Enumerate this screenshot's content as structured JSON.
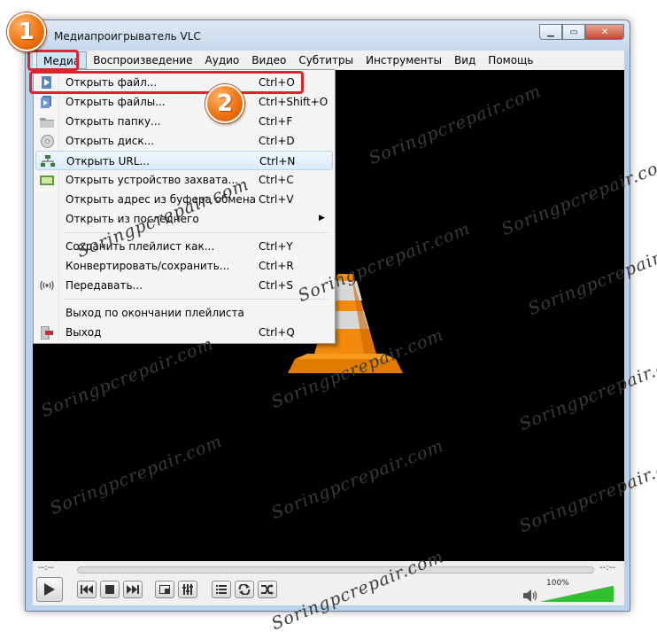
{
  "window": {
    "title": "Медиапроигрыватель VLC"
  },
  "menubar": [
    {
      "label": "Медиа"
    },
    {
      "label": "Воспроизведение"
    },
    {
      "label": "Аудио"
    },
    {
      "label": "Видео"
    },
    {
      "label": "Субтитры"
    },
    {
      "label": "Инструменты"
    },
    {
      "label": "Вид"
    },
    {
      "label": "Помощь"
    }
  ],
  "media_menu": [
    {
      "label": "Открыть файл...",
      "shortcut": "Ctrl+O",
      "icon": "open-file-icon"
    },
    {
      "label": "Открыть файлы...",
      "shortcut": "Ctrl+Shift+O",
      "icon": "open-files-icon"
    },
    {
      "label": "Открыть папку...",
      "shortcut": "Ctrl+F",
      "icon": "folder-icon"
    },
    {
      "label": "Открыть диск...",
      "shortcut": "Ctrl+D",
      "icon": "disc-icon"
    },
    {
      "label": "Открыть URL...",
      "shortcut": "Ctrl+N",
      "icon": "network-icon"
    },
    {
      "label": "Открыть устройство захвата...",
      "shortcut": "Ctrl+C",
      "icon": "capture-device-icon"
    },
    {
      "label": "Открыть адрес из буфера обмена",
      "shortcut": "Ctrl+V",
      "icon": ""
    },
    {
      "label": "Открыть из последнего",
      "shortcut": "",
      "icon": ""
    },
    {
      "label": "Сохранить плейлист как...",
      "shortcut": "Ctrl+Y",
      "icon": ""
    },
    {
      "label": "Конвертировать/сохранить...",
      "shortcut": "Ctrl+R",
      "icon": ""
    },
    {
      "label": "Передавать...",
      "shortcut": "Ctrl+S",
      "icon": "stream-icon"
    },
    {
      "label": "Выход по окончании плейлиста",
      "shortcut": "",
      "icon": ""
    },
    {
      "label": "Выход",
      "shortcut": "Ctrl+Q",
      "icon": "exit-icon"
    }
  ],
  "controls": {
    "time_elapsed": "--:--",
    "time_total": "--:--",
    "volume_label": "100%",
    "volume_level": 1.0
  },
  "callouts": {
    "step1": "1",
    "step2": "2"
  },
  "watermark": "Soringpcrepair.com",
  "colors": {
    "highlight": "#d7272f",
    "badge": "#f07412",
    "volume": "#2fbf2f"
  }
}
